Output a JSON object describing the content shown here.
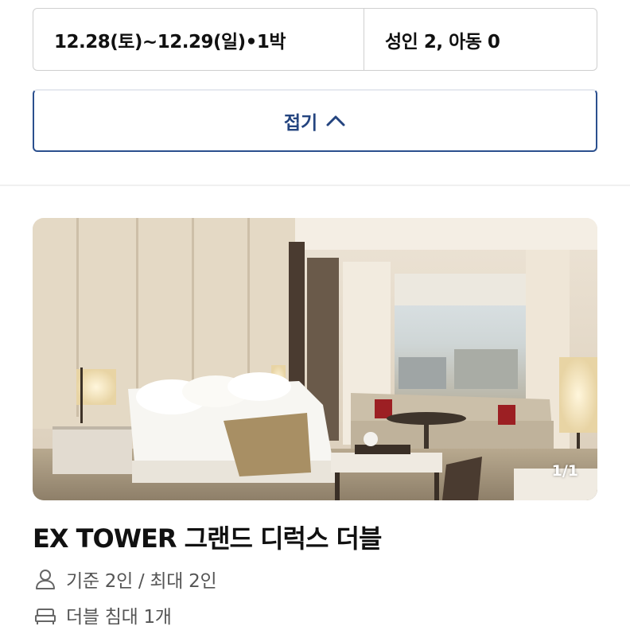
{
  "search": {
    "dates": "12.28(토)~12.29(일)•1박",
    "guests": "성인 2, 아동 0"
  },
  "collapse": {
    "label": "접기",
    "icon": "chevron-up-icon",
    "color": "#24447f"
  },
  "room": {
    "photo_counter": "1/1",
    "title": "EX TOWER 그랜드 디럭스 더블",
    "capacity": "기준 2인 / 최대 2인",
    "capacity_icon": "person-icon",
    "bed": "더블 침대 1개",
    "bed_icon": "bed-icon"
  }
}
